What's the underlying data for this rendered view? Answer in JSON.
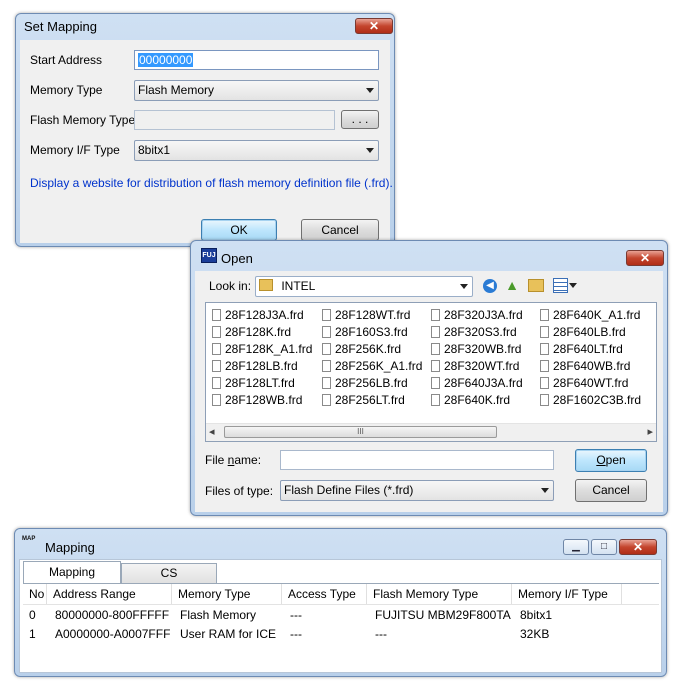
{
  "set_mapping": {
    "title": "Set Mapping",
    "close_glyph": "✕",
    "start_address_label": "Start Address",
    "start_address_value": "00000000",
    "memory_type_label": "Memory Type",
    "memory_type_value": "Flash Memory",
    "flash_type_label": "Flash Memory Type",
    "flash_type_value": "",
    "browse_label": ". . .",
    "memory_if_label": "Memory I/F Type",
    "memory_if_value": "8bitx1",
    "link_text": "Display a website for distribution of flash memory definition file (.frd).",
    "ok_label": "OK",
    "cancel_label": "Cancel"
  },
  "open_dialog": {
    "title": "Open",
    "close_glyph": "✕",
    "look_in_label": "Look in:",
    "look_in_value": "INTEL",
    "files": [
      [
        "28F128J3A.frd",
        "28F128K.frd",
        "28F128K_A1.frd",
        "28F128LB.frd",
        "28F128LT.frd",
        "28F128WB.frd"
      ],
      [
        "28F128WT.frd",
        "28F160S3.frd",
        "28F256K.frd",
        "28F256K_A1.frd",
        "28F256LB.frd",
        "28F256LT.frd"
      ],
      [
        "28F320J3A.frd",
        "28F320S3.frd",
        "28F320WB.frd",
        "28F320WT.frd",
        "28F640J3A.frd",
        "28F640K.frd"
      ],
      [
        "28F640K_A1.frd",
        "28F640LB.frd",
        "28F640LT.frd",
        "28F640WB.frd",
        "28F640WT.frd",
        "28F1602C3B.frd"
      ]
    ],
    "file_name_label_pre": "File ",
    "file_name_label_u": "n",
    "file_name_label_post": "ame:",
    "file_name_value": "",
    "files_of_type_label": "Files of type:",
    "files_of_type_value": "Flash Define Files (*.frd)",
    "open_label_u": "O",
    "open_label_post": "pen",
    "cancel_label": "Cancel",
    "scroll_left": "◂",
    "scroll_right": "▸",
    "scroll_thumb_grip": "III"
  },
  "mapping_window": {
    "title": "Mapping",
    "icon_text": "MAP",
    "minimize_glyph": "▁",
    "maximize_glyph": "□",
    "close_glyph": "✕",
    "tabs": [
      "Mapping",
      "CS"
    ],
    "columns": [
      "No",
      "Address Range",
      "Memory Type",
      "Access Type",
      "Flash Memory Type",
      "Memory I/F Type"
    ],
    "rows": [
      [
        "0",
        "80000000-800FFFFF",
        "Flash Memory",
        "---",
        "FUJITSU MBM29F800TA",
        "8bitx1"
      ],
      [
        "1",
        "A0000000-A0007FFF",
        "User RAM for ICE",
        "---",
        "---",
        "32KB"
      ]
    ]
  },
  "colors": {
    "titlebar": "#bed3ec",
    "link": "#0033cc",
    "selection": "#3399ff",
    "close_button": "#c4452e"
  }
}
